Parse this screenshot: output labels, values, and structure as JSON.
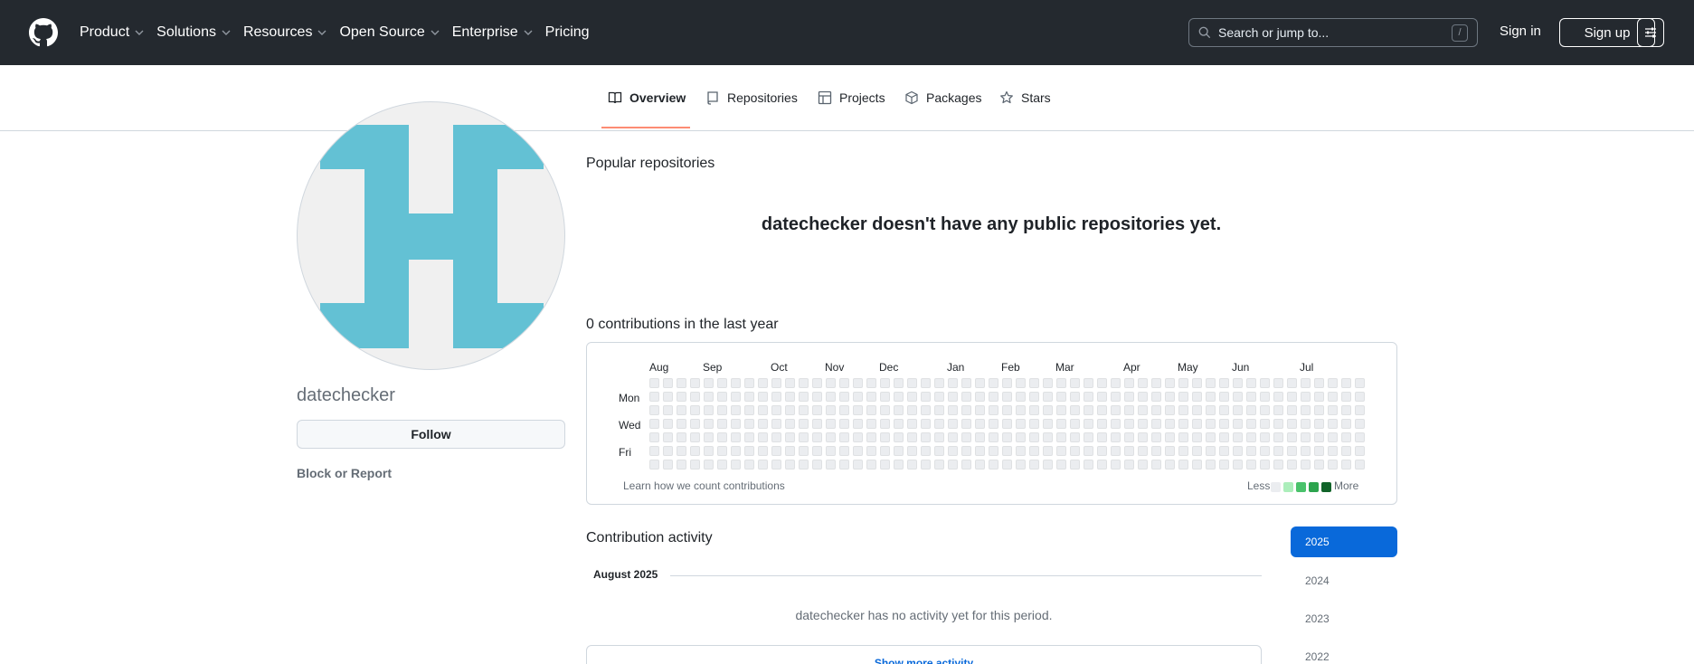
{
  "header": {
    "nav": [
      {
        "label": "Product",
        "has_dropdown": true
      },
      {
        "label": "Solutions",
        "has_dropdown": true
      },
      {
        "label": "Resources",
        "has_dropdown": true
      },
      {
        "label": "Open Source",
        "has_dropdown": true
      },
      {
        "label": "Enterprise",
        "has_dropdown": true
      },
      {
        "label": "Pricing",
        "has_dropdown": false
      }
    ],
    "search_placeholder": "Search or jump to...",
    "search_shortcut": "/",
    "sign_in": "Sign in",
    "sign_up": "Sign up",
    "background": "#24292f"
  },
  "tabs": [
    {
      "label": "Overview",
      "icon": "book-icon",
      "active": true
    },
    {
      "label": "Repositories",
      "icon": "repo-icon",
      "active": false
    },
    {
      "label": "Projects",
      "icon": "table-icon",
      "active": false
    },
    {
      "label": "Packages",
      "icon": "package-icon",
      "active": false
    },
    {
      "label": "Stars",
      "icon": "star-icon",
      "active": false
    }
  ],
  "profile": {
    "username": "datechecker",
    "follow_label": "Follow",
    "block_label": "Block or Report",
    "avatar_color": "#63c1d4"
  },
  "popular": {
    "title": "Popular repositories",
    "empty_message": "datechecker doesn't have any public repositories yet."
  },
  "contributions": {
    "title": "0 contributions in the last year",
    "months": [
      "Aug",
      "Sep",
      "Oct",
      "Nov",
      "Dec",
      "Jan",
      "Feb",
      "Mar",
      "Apr",
      "May",
      "Jun",
      "Jul"
    ],
    "day_labels": [
      "Mon",
      "Wed",
      "Fri"
    ],
    "learn_link": "Learn how we count contributions",
    "legend_less": "Less",
    "legend_more": "More",
    "legend_colors": [
      "#ebedf0",
      "#aceebb",
      "#4ac26b",
      "#2da44e",
      "#116329"
    ]
  },
  "activity": {
    "title": "Contribution activity",
    "month_heading": "August 2025",
    "empty_message": "datechecker has no activity yet for this period.",
    "show_more": "Show more activity",
    "years": [
      {
        "label": "2025",
        "active": true
      },
      {
        "label": "2024",
        "active": false
      },
      {
        "label": "2023",
        "active": false
      },
      {
        "label": "2022",
        "active": false
      }
    ],
    "accent": "#0969da"
  }
}
